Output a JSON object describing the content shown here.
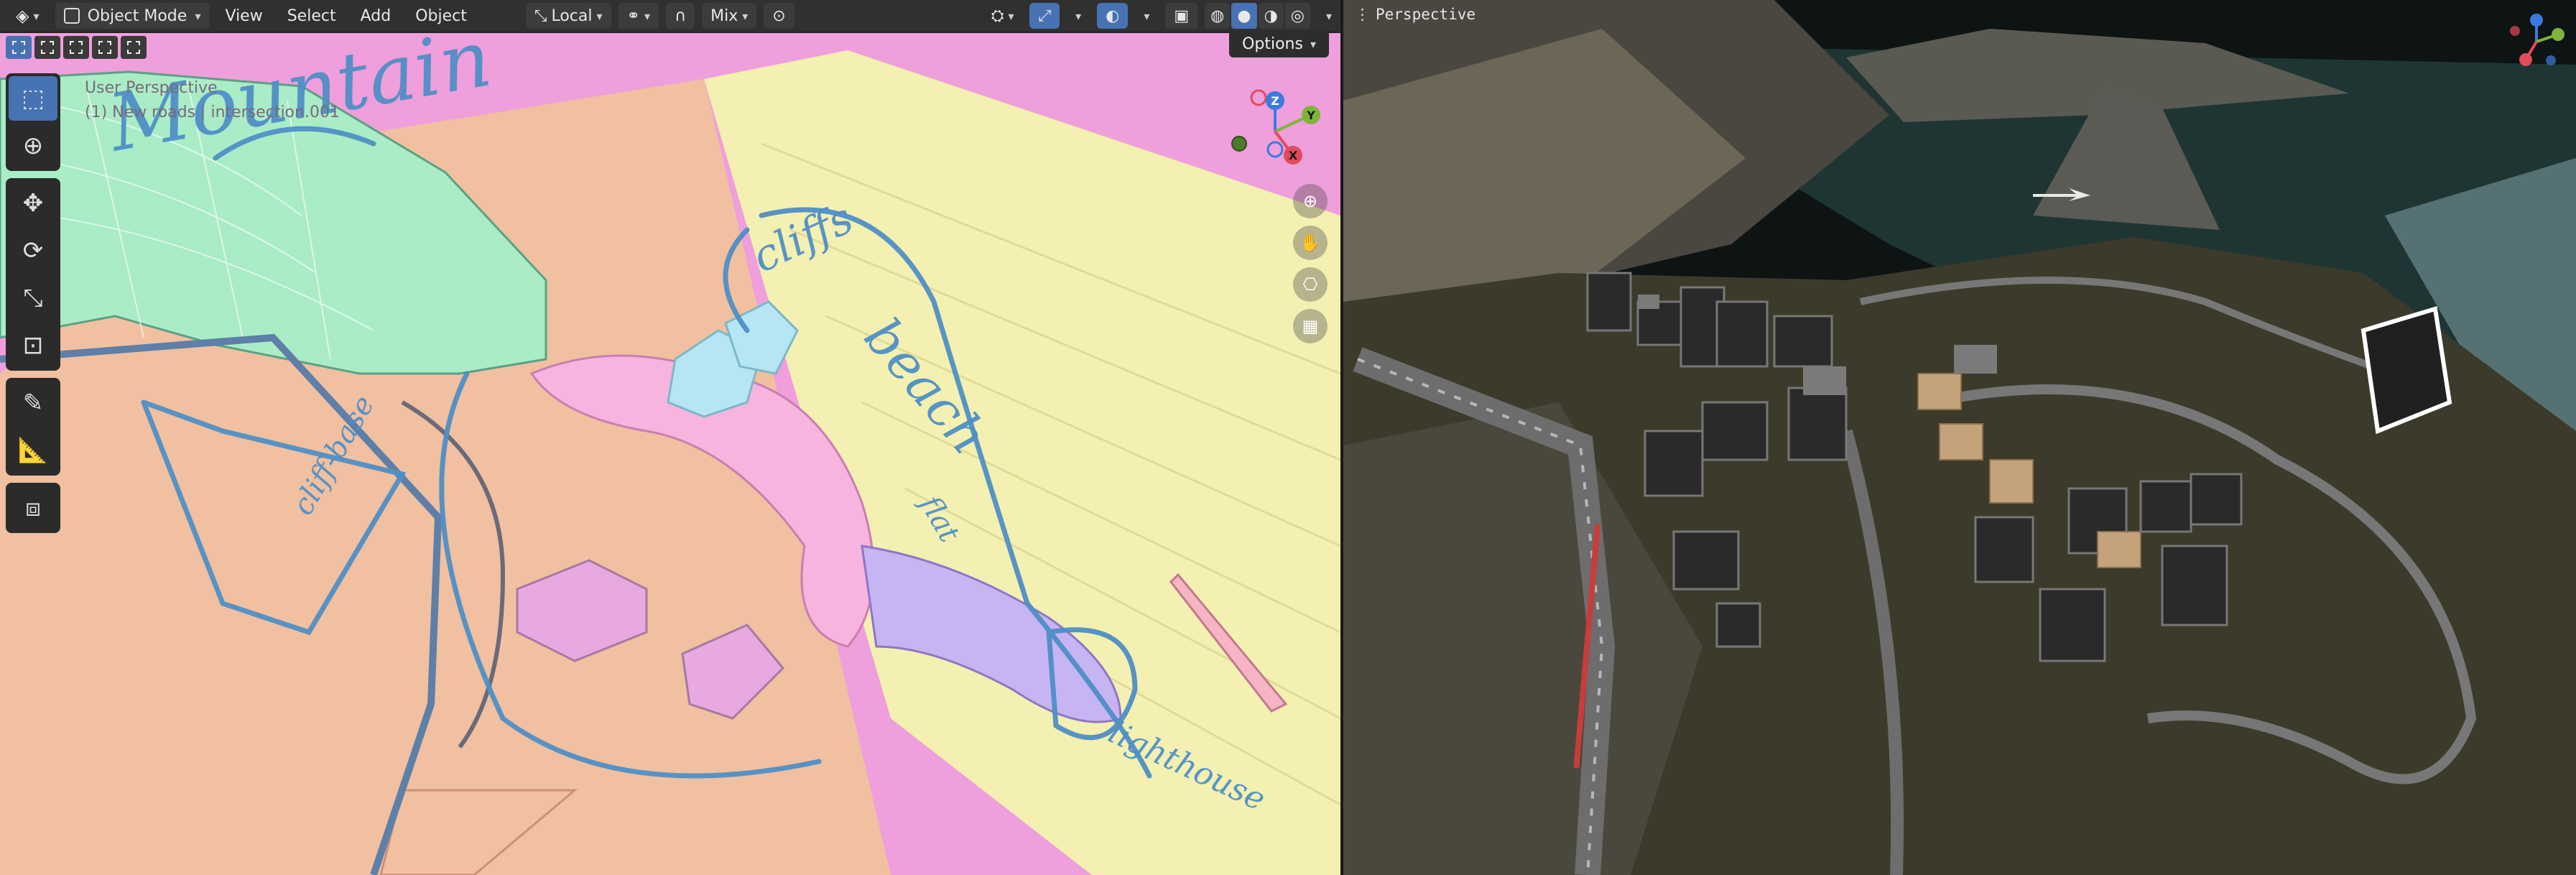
{
  "header": {
    "mode_label": "Object Mode",
    "menu": [
      "View",
      "Select",
      "Add",
      "Object"
    ],
    "transform_orientation": "Local",
    "proportional_falloff": "Mix"
  },
  "options_label": "Options",
  "viewport_left": {
    "view_name": "User Perspective",
    "object_info": "(1) New roads | intersection.001",
    "annotations": [
      "Mountain",
      "cliffs",
      "beach",
      "cliff-base",
      "flat",
      "lighthouse"
    ]
  },
  "viewport_right": {
    "view_name": "Perspective"
  },
  "gizmo_axes": {
    "z": "Z",
    "y": "Y",
    "x": "X"
  },
  "colors": {
    "header_bg": "#303030",
    "accent": "#4772b3",
    "axis_x": "#e24b5a",
    "axis_y": "#7fb43c",
    "axis_z": "#3c7ae0"
  }
}
